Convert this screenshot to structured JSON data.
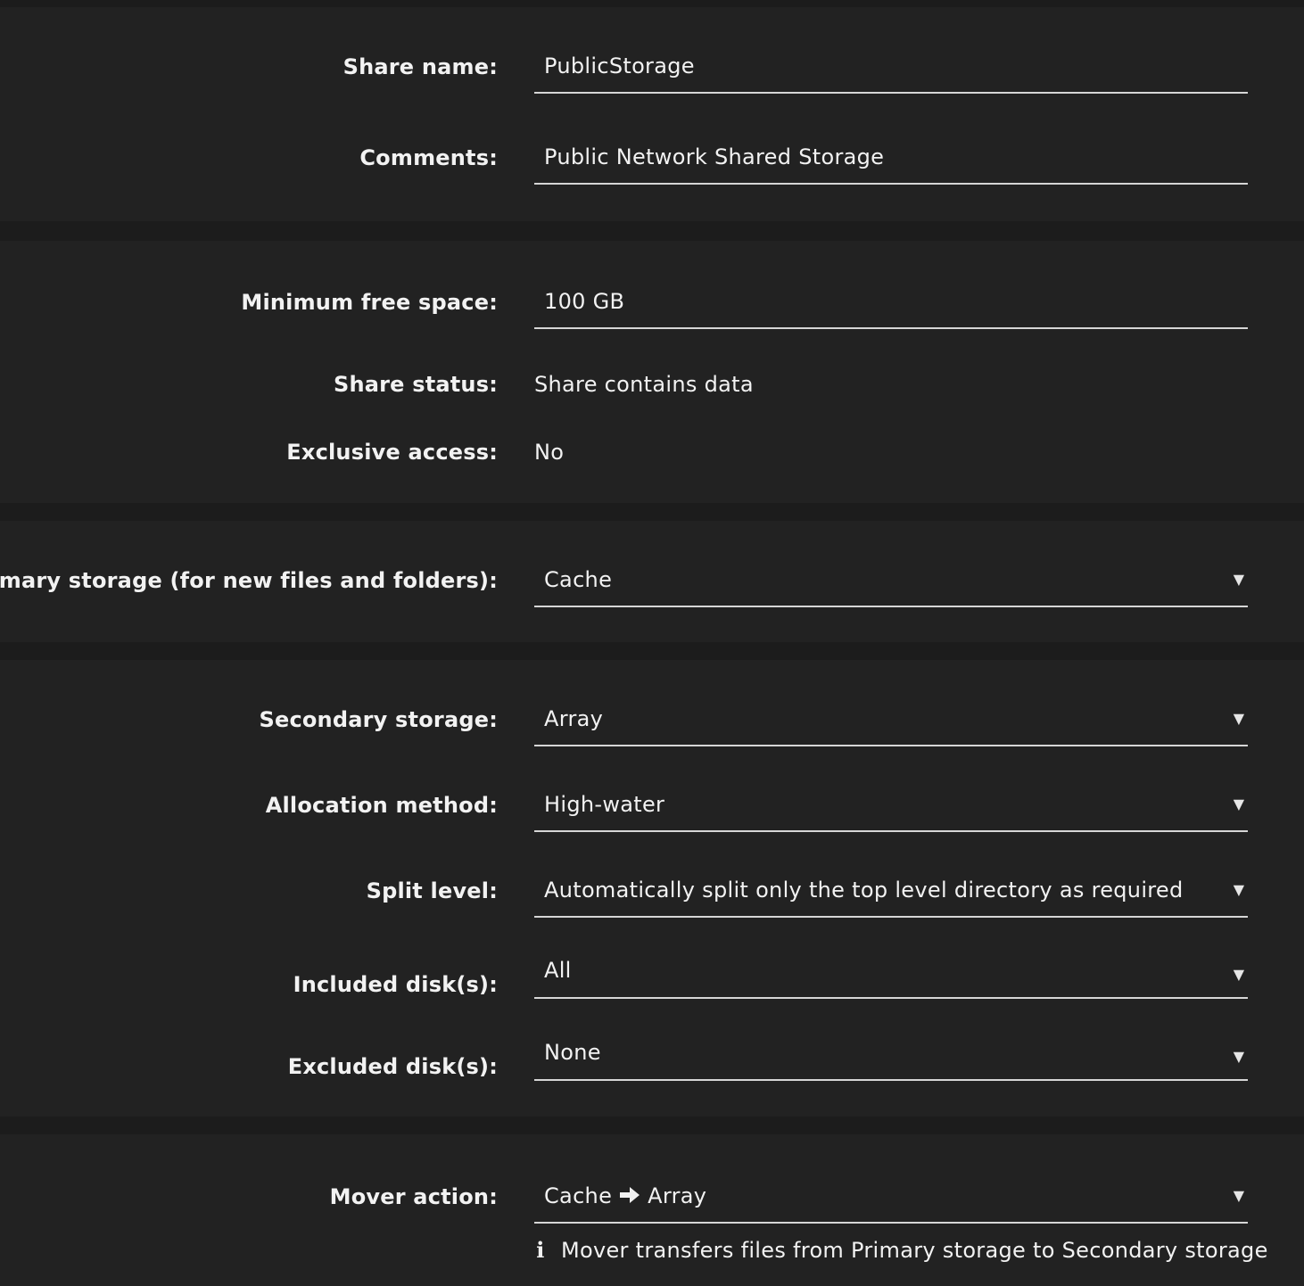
{
  "general": {
    "share_name": {
      "label": "Share name:",
      "value": "PublicStorage"
    },
    "comments": {
      "label": "Comments:",
      "value": "Public Network Shared Storage"
    }
  },
  "space": {
    "min_free": {
      "label": "Minimum free space:",
      "value": "100 GB"
    },
    "share_status": {
      "label": "Share status:",
      "value": "Share contains data"
    },
    "exclusive_access": {
      "label": "Exclusive access:",
      "value": "No"
    }
  },
  "primary": {
    "primary_storage": {
      "label": "Primary storage (for new files and folders):",
      "value": "Cache"
    }
  },
  "secondary": {
    "secondary_storage": {
      "label": "Secondary storage:",
      "value": "Array"
    },
    "allocation": {
      "label": "Allocation method:",
      "value": "High-water"
    },
    "split_level": {
      "label": "Split level:",
      "value": "Automatically split only the top level directory as required"
    },
    "included_disks": {
      "label": "Included disk(s):",
      "value": "All"
    },
    "excluded_disks": {
      "label": "Excluded disk(s):",
      "value": "None"
    }
  },
  "mover": {
    "label": "Mover action:",
    "from": "Cache",
    "to": "Array",
    "info": "Mover transfers files from Primary storage to Secondary storage"
  },
  "icons": {
    "dropdown": "chevron-down-icon",
    "arrow": "arrow-right-icon",
    "info": "info-icon"
  }
}
